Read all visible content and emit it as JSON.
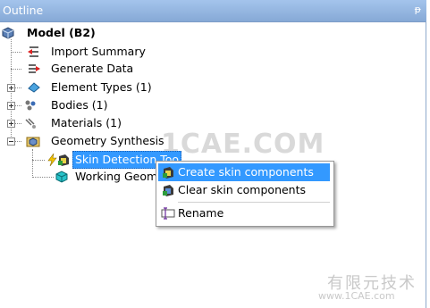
{
  "panel": {
    "title": "Outline",
    "pin": "ᵽ"
  },
  "tree": {
    "root": "Model (B2)",
    "items": [
      {
        "label": "Import Summary"
      },
      {
        "label": "Generate Data"
      },
      {
        "label": "Element Types (1)"
      },
      {
        "label": "Bodies (1)"
      },
      {
        "label": "Materials (1)"
      },
      {
        "label": "Geometry Synthesis"
      }
    ],
    "children": [
      {
        "label": "Skin Detection Too"
      },
      {
        "label": "Working Geom"
      }
    ]
  },
  "context_menu": {
    "items": [
      {
        "label": "Create skin components",
        "icon": "create-skin-icon"
      },
      {
        "label": "Clear skin components",
        "icon": "clear-skin-icon"
      },
      {
        "label": "Rename",
        "icon": "rename-icon"
      }
    ]
  },
  "watermark": {
    "main": "1CAE.COM",
    "cn": "有限元技术",
    "url": "www.1CAE.com"
  },
  "colors": {
    "header": "#94b6e2",
    "selection": "#3399ff"
  }
}
